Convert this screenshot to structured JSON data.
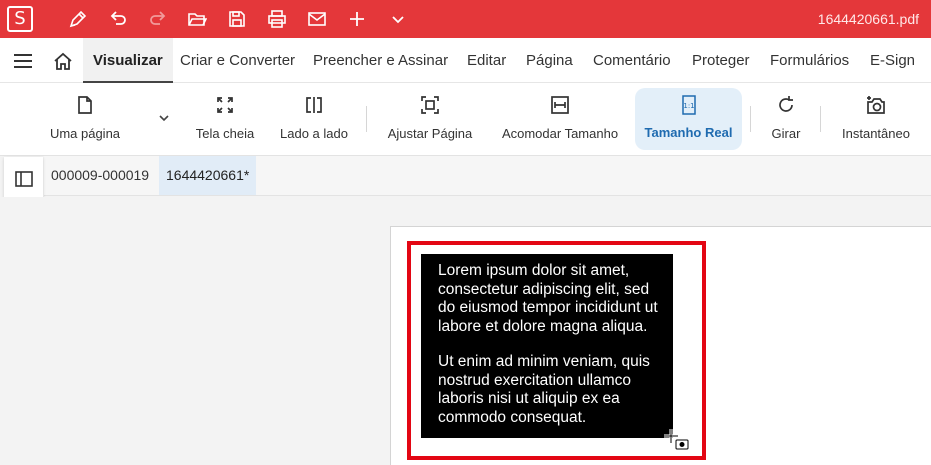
{
  "titlebar": {
    "logo": "S",
    "filename": "1644420661.pdf",
    "icons": [
      "pen-icon",
      "undo-icon",
      "redo-icon",
      "open-folder-icon",
      "save-icon",
      "print-icon",
      "mail-icon",
      "plus-icon",
      "chevron-down-icon"
    ]
  },
  "menu": {
    "tabs": [
      "Visualizar",
      "Criar e Converter",
      "Preencher e Assinar",
      "Editar",
      "Página",
      "Comentário",
      "Proteger",
      "Formulários",
      "E-Sign"
    ],
    "active": "Visualizar"
  },
  "ribbon": {
    "uma_pagina": "Uma página",
    "tela_cheia": "Tela cheia",
    "lado_a_lado": "Lado a lado",
    "ajustar_pagina": "Ajustar Página",
    "acomodar_tamanho": "Acomodar Tamanho",
    "tamanho_real": "Tamanho Real",
    "tamanho_real_icon_text": "1:1",
    "girar": "Girar",
    "instantaneo": "Instantâneo"
  },
  "doc_tabs": [
    "000009-000019",
    "1644420661*"
  ],
  "document": {
    "paragraph1": "Lorem ipsum dolor sit amet, consectetur adipiscing elit, sed do eiusmod tempor incididunt ut labore et dolore magna aliqua.",
    "paragraph2": "Ut enim ad minim veniam, quis nostrud exercitation ullamco laboris nisi ut aliquip ex ea commodo consequat."
  },
  "colors": {
    "titlebar": "#e4373a",
    "selection_border": "#e30613",
    "active_ribbon_bg": "#e3eff9",
    "active_ribbon_text": "#1f6bb0"
  }
}
